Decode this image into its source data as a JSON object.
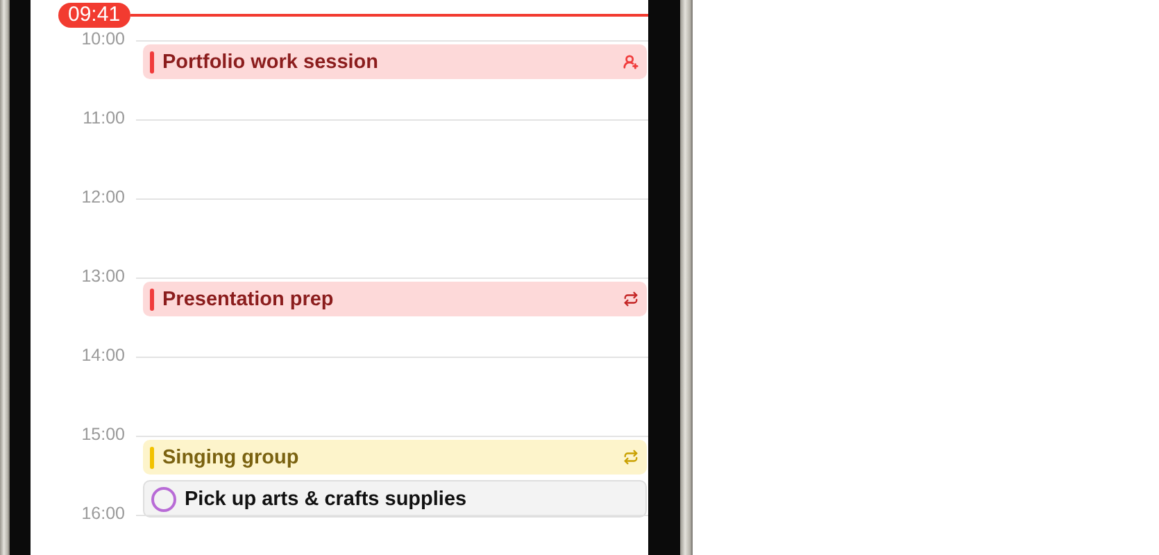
{
  "now_time": "09:41",
  "hours": [
    {
      "label": "10:00",
      "events": [
        {
          "kind": "event",
          "title": "Portfolio work session",
          "color": "#f03b3b",
          "shared": true,
          "repeating": false
        }
      ]
    },
    {
      "label": "11:00"
    },
    {
      "label": "12:00"
    },
    {
      "label": "13:00",
      "events": [
        {
          "kind": "event",
          "title": "Presentation prep",
          "color": "#f03b3b",
          "shared": false,
          "repeating": true
        }
      ]
    },
    {
      "label": "14:00"
    },
    {
      "label": "15:00",
      "events": [
        {
          "kind": "event",
          "title": "Singing group",
          "color": "#f2c200",
          "shared": false,
          "repeating": true
        },
        {
          "kind": "reminder",
          "title": "Pick up arts & crafts supplies",
          "color": "#b86bd6",
          "completed": false
        }
      ]
    },
    {
      "label": "16:00"
    }
  ]
}
